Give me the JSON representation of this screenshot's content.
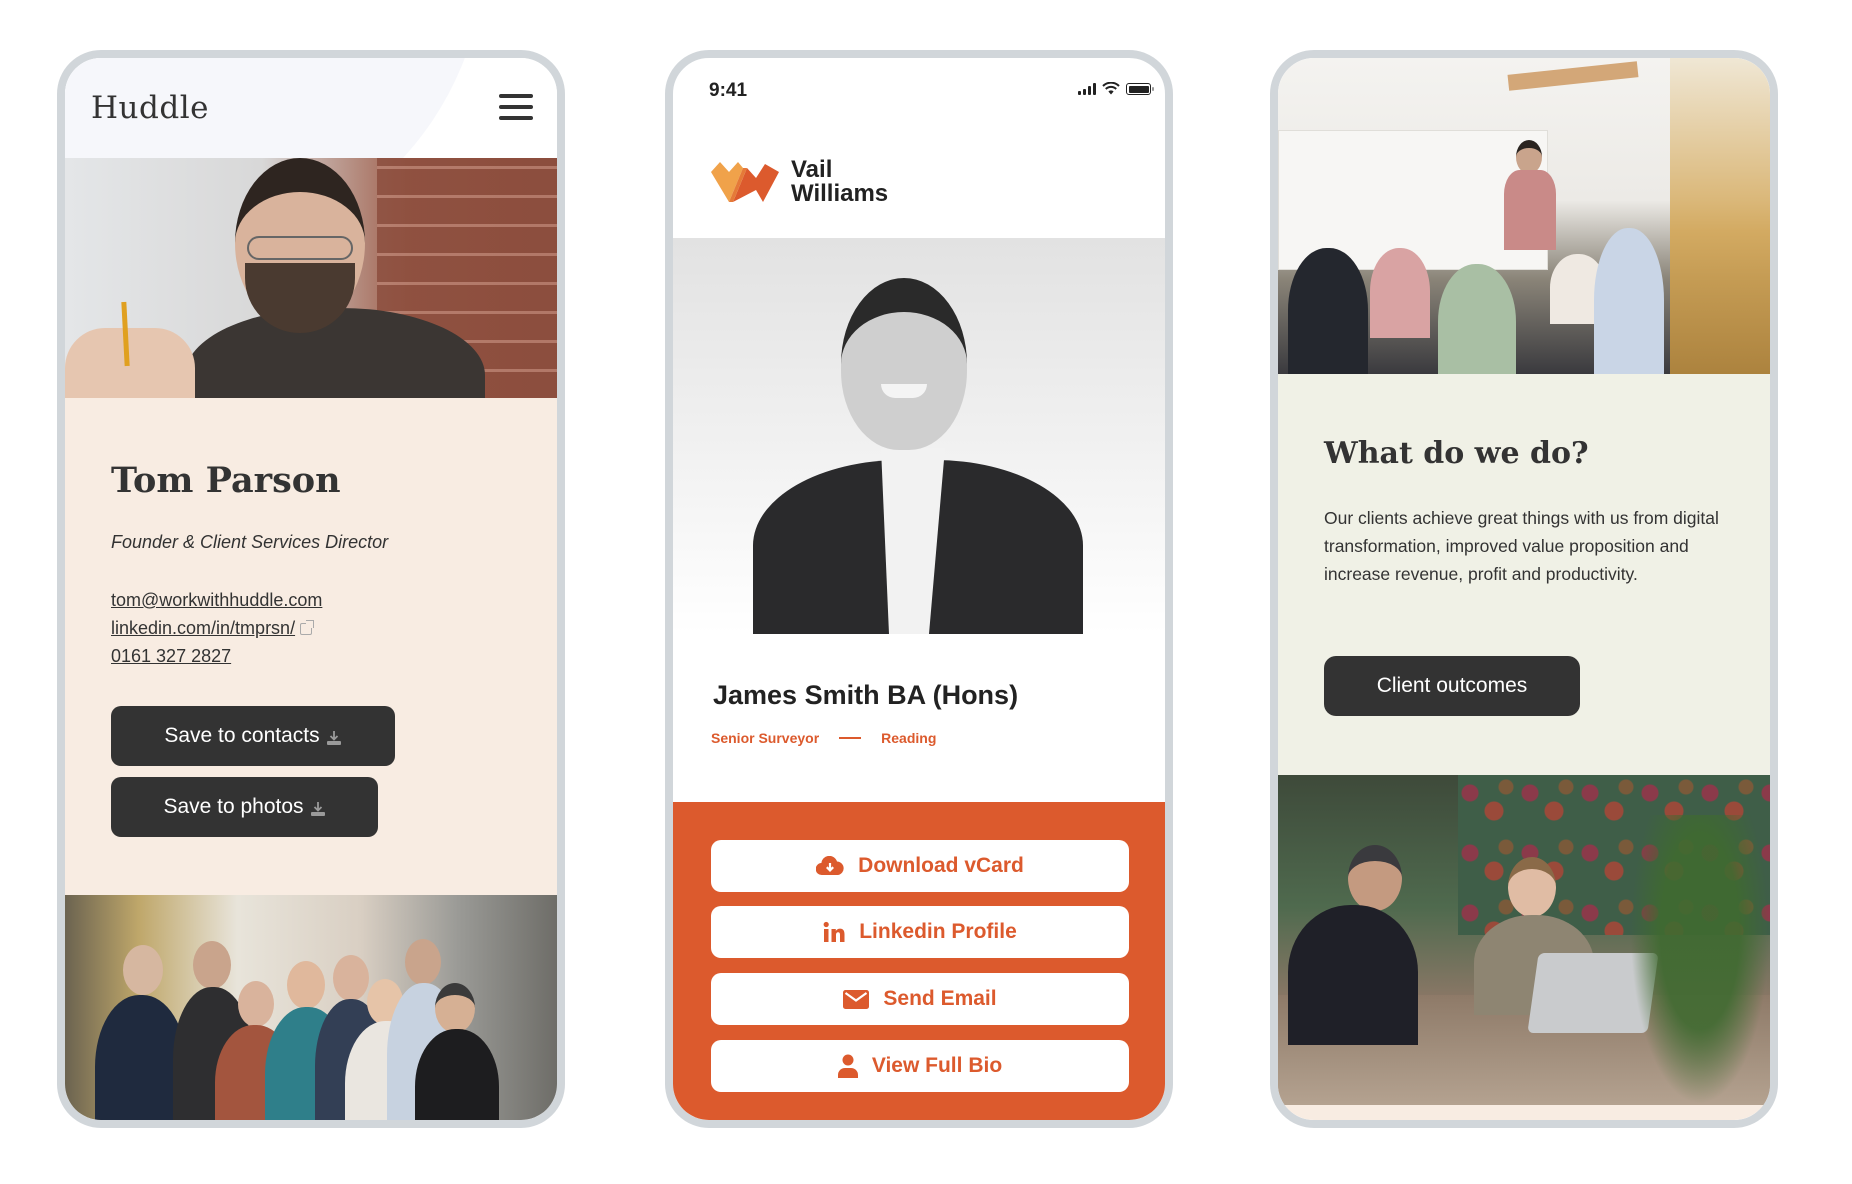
{
  "huddle": {
    "logo": "Huddle",
    "menu_icon": "hamburger-menu-icon",
    "profile": {
      "name": "Tom Parson",
      "role": "Founder & Client Services Director",
      "email": "tom@workwithhuddle.com",
      "linkedin": "linkedin.com/in/tmprsn/",
      "phone": "0161 327 2827"
    },
    "buttons": {
      "save_contacts": "Save to contacts",
      "save_photos": "Save to photos"
    },
    "colors": {
      "card_bg": "#f8ece2",
      "button_bg": "#333333",
      "text": "#333333"
    }
  },
  "vail": {
    "status_bar": {
      "time": "9:41"
    },
    "logo": {
      "line1": "Vail",
      "line2": "Williams"
    },
    "profile": {
      "name": "James Smith BA (Hons)",
      "title": "Senior Surveyor",
      "location": "Reading"
    },
    "buttons": [
      {
        "label": "Download vCard",
        "icon": "cloud-download-icon"
      },
      {
        "label": "Linkedin Profile",
        "icon": "linkedin-icon"
      },
      {
        "label": "Send Email",
        "icon": "envelope-icon"
      },
      {
        "label": "View Full Bio",
        "icon": "user-icon"
      }
    ],
    "colors": {
      "brand_orange": "#dc5a2d",
      "brand_amber": "#f0a24a"
    }
  },
  "outcomes": {
    "heading": "What do we do?",
    "body": "Our clients achieve great things with us from digital transformation, improved value proposition and increase revenue, profit and productivity.",
    "button": "Client outcomes",
    "colors": {
      "section_bg": "#f0f1e6",
      "button_bg": "#333333"
    }
  }
}
